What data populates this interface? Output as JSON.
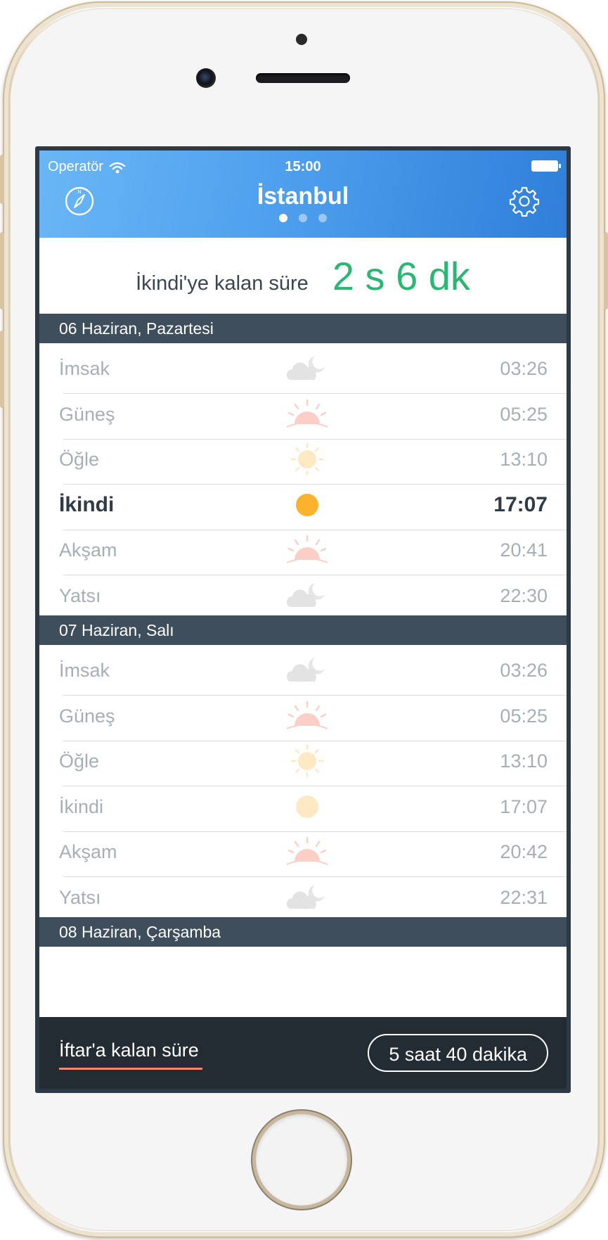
{
  "status_bar": {
    "carrier": "Operatör",
    "time": "15:00"
  },
  "header": {
    "city": "İstanbul",
    "page_count": 3,
    "active_page": 1
  },
  "countdown": {
    "label": "İkindi'ye kalan süre",
    "value": "2 s 6 dk"
  },
  "days": [
    {
      "date": "06 Haziran, Pazartesi",
      "prayers": [
        {
          "name": "İmsak",
          "time": "03:26",
          "icon": "moon-cloud-icon",
          "state": "dim"
        },
        {
          "name": "Güneş",
          "time": "05:25",
          "icon": "sunrise-icon",
          "state": "dim"
        },
        {
          "name": "Öğle",
          "time": "13:10",
          "icon": "sun-icon",
          "state": "dim"
        },
        {
          "name": "İkindi",
          "time": "17:07",
          "icon": "sun-disc-icon",
          "state": "active"
        },
        {
          "name": "Akşam",
          "time": "20:41",
          "icon": "sunset-icon",
          "state": "dim"
        },
        {
          "name": "Yatsı",
          "time": "22:30",
          "icon": "moon-cloud-icon",
          "state": "dim"
        }
      ]
    },
    {
      "date": "07 Haziran, Salı",
      "prayers": [
        {
          "name": "İmsak",
          "time": "03:26",
          "icon": "moon-cloud-icon",
          "state": "dim"
        },
        {
          "name": "Güneş",
          "time": "05:25",
          "icon": "sunrise-icon",
          "state": "dim"
        },
        {
          "name": "Öğle",
          "time": "13:10",
          "icon": "sun-icon",
          "state": "dim"
        },
        {
          "name": "İkindi",
          "time": "17:07",
          "icon": "sun-disc-icon",
          "state": "dim"
        },
        {
          "name": "Akşam",
          "time": "20:42",
          "icon": "sunset-icon",
          "state": "dim"
        },
        {
          "name": "Yatsı",
          "time": "22:31",
          "icon": "moon-cloud-icon",
          "state": "dim"
        }
      ]
    },
    {
      "date": "08 Haziran, Çarşamba",
      "prayers": []
    }
  ],
  "footer": {
    "label": "İftar'a kalan süre",
    "value": "5 saat 40 dakika"
  },
  "colors": {
    "header_start": "#6ab6f6",
    "header_end": "#2f7fd9",
    "countdown_green": "#2bb673",
    "day_header": "#3e4e5c",
    "footer_bg": "#232b33",
    "accent_underline": "#f08a6a",
    "active_sun": "#fbb22c"
  }
}
